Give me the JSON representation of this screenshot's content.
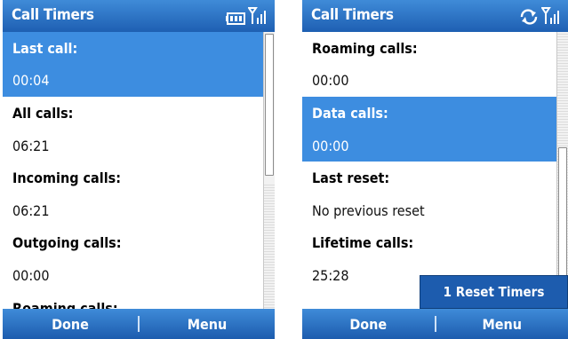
{
  "left": {
    "title": "Call Timers",
    "rows": [
      {
        "label": "Last call:",
        "value": "00:04"
      },
      {
        "label": "All calls:",
        "value": "06:21"
      },
      {
        "label": "Incoming calls:",
        "value": "06:21"
      },
      {
        "label": "Outgoing calls:",
        "value": "00:00"
      },
      {
        "label": "Roaming calls:"
      }
    ],
    "softkeys": {
      "left": "Done",
      "right": "Menu"
    }
  },
  "right": {
    "title": "Call Timers",
    "rows": [
      {
        "label": "Roaming calls:",
        "value": "00:00"
      },
      {
        "label": "Data calls:",
        "value": "00:00"
      },
      {
        "label": "Last reset:",
        "value": "No previous reset"
      },
      {
        "label": "Lifetime calls:",
        "value": "25:28"
      }
    ],
    "menu_popup": "1 Reset Timers",
    "softkeys": {
      "left": "Done",
      "right": "Menu"
    }
  },
  "icons": {
    "battery": "battery-icon",
    "signal": "signal-icon",
    "sync": "sync-arrows-icon"
  },
  "colors": {
    "titlebar": "#2a72c6",
    "selection": "#3d8de0",
    "softkey": "#2a72c6"
  }
}
